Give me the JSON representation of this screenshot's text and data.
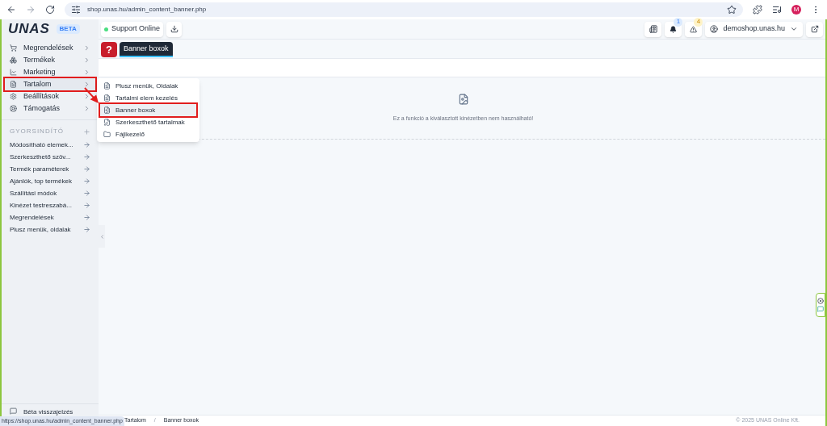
{
  "browser": {
    "url": "shop.unas.hu/admin_content_banner.php",
    "profile_initial": "M"
  },
  "sidebar": {
    "logo": "UNAS",
    "badge": "BETA",
    "items": [
      {
        "label": "Megrendelések",
        "selected": false
      },
      {
        "label": "Termékek",
        "selected": false
      },
      {
        "label": "Marketing",
        "selected": false
      },
      {
        "label": "Tartalom",
        "selected": true
      },
      {
        "label": "Beállítások",
        "selected": false
      },
      {
        "label": "Támogatás",
        "selected": false
      }
    ],
    "quick_title": "GYORSINDÍTÓ",
    "quick_items": [
      "Módosítható elemek...",
      "Szerkeszthető szöv...",
      "Termék paraméterek",
      "Ajánlók, top termékek",
      "Szállítási módok",
      "Kinézet testreszabá...",
      "Megrendelések",
      "Plusz menük, oldalak"
    ],
    "feedback": "Béta visszajelzés"
  },
  "flyout": {
    "items": [
      {
        "label": "Plusz menük, Oldalak",
        "selected": false
      },
      {
        "label": "Tartalmi elem kezelés",
        "selected": false
      },
      {
        "label": "Banner boxok",
        "selected": true
      },
      {
        "label": "Szerkeszthető tartalmak",
        "selected": false
      },
      {
        "label": "Fájlkezelő",
        "selected": false
      }
    ]
  },
  "topbar": {
    "support": "Support Online",
    "notifications": "1",
    "warnings": "4",
    "shop": "demoshop.unas.hu"
  },
  "page": {
    "help": "?",
    "tab": "Banner boxok",
    "message": "Ez a funkció a kiválasztott kinézetben nem használható!"
  },
  "breadcrumb": [
    "Tartalom",
    "Banner boxok"
  ],
  "breadcrumb_separator": "/",
  "copyright": "© 2025 UNAS Online Kft.",
  "status_link": "https://shop.unas.hu/admin_content_banner.php"
}
